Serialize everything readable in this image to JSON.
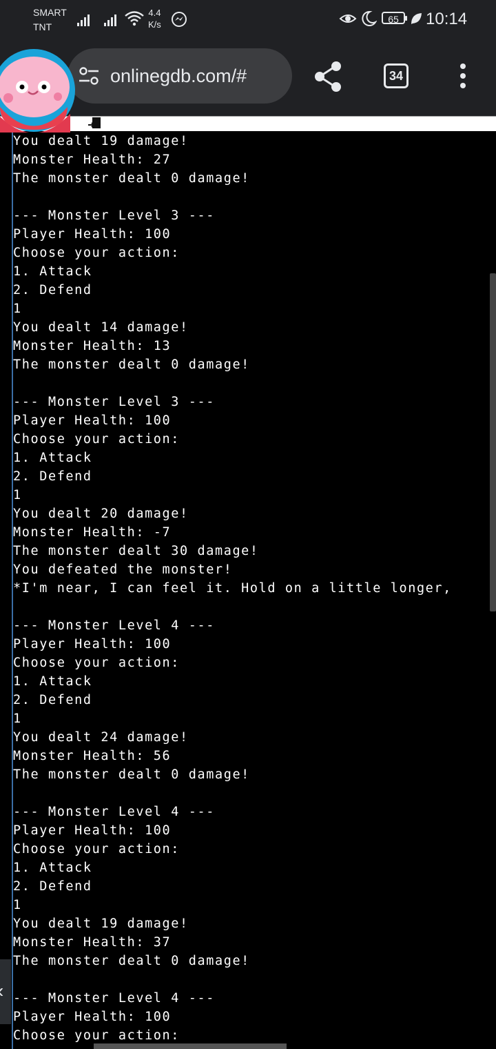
{
  "status_bar": {
    "carrier_line1": "SMART",
    "carrier_line2": "TNT",
    "speed_value": "4.4",
    "speed_unit": "K/s",
    "battery_level": "65",
    "time": "10:14",
    "icons": [
      "signal-icon",
      "signal-icon",
      "wifi-icon",
      "messenger-icon",
      "eye-comfort-icon",
      "moon-icon",
      "battery-icon",
      "leaf-icon"
    ]
  },
  "browser": {
    "url": "onlinegdb.com/#",
    "tab_count": "34",
    "icons": [
      "site-settings-icon",
      "share-icon",
      "tabs-icon",
      "more-menu-icon"
    ]
  },
  "console": {
    "lines": [
      "You dealt 19 damage!",
      "Monster Health: 27",
      "The monster dealt 0 damage!",
      "",
      "--- Monster Level 3 ---",
      "Player Health: 100",
      "Choose your action:",
      "1. Attack",
      "2. Defend",
      "1",
      "You dealt 14 damage!",
      "Monster Health: 13",
      "The monster dealt 0 damage!",
      "",
      "--- Monster Level 3 ---",
      "Player Health: 100",
      "Choose your action:",
      "1. Attack",
      "2. Defend",
      "1",
      "You dealt 20 damage!",
      "Monster Health: -7",
      "The monster dealt 30 damage!",
      "You defeated the monster!",
      "*I'm near, I can feel it. Hold on a little longer,",
      "",
      "--- Monster Level 4 ---",
      "Player Health: 100",
      "Choose your action:",
      "1. Attack",
      "2. Defend",
      "1",
      "You dealt 24 damage!",
      "Monster Health: 56",
      "The monster dealt 0 damage!",
      "",
      "--- Monster Level 4 ---",
      "Player Health: 100",
      "Choose your action:",
      "1. Attack",
      "2. Defend",
      "1",
      "You dealt 19 damage!",
      "Monster Health: 37",
      "The monster dealt 0 damage!",
      "",
      "--- Monster Level 4 ---",
      "Player Health: 100",
      "Choose your action:"
    ]
  },
  "colors": {
    "toolbar": "#202124",
    "omnibox": "#3c3d40",
    "console_bg": "#000000",
    "console_text": "#ffffff",
    "avatar_pink": "#f8b6cd",
    "avatar_ring": "#1aa3d9"
  }
}
